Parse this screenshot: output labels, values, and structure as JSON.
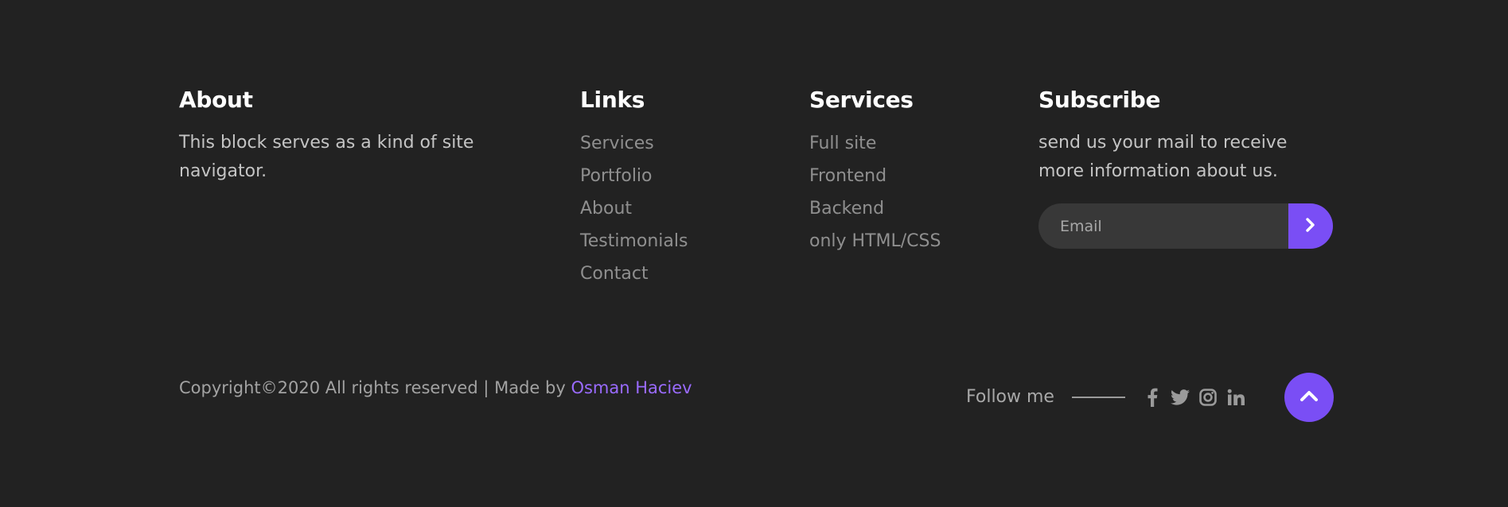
{
  "about": {
    "title": "About",
    "text": "This block serves as a kind of site navigator."
  },
  "links": {
    "title": "Links",
    "items": [
      "Services",
      "Portfolio",
      "About",
      "Testimonials",
      "Contact"
    ]
  },
  "services": {
    "title": "Services",
    "items": [
      "Full site",
      "Frontend",
      "Backend",
      "only HTML/CSS"
    ]
  },
  "subscribe": {
    "title": "Subscribe",
    "text": "send us your mail to receive more information about us.",
    "placeholder": "Email",
    "submit_icon": "chevron-right-icon"
  },
  "bottom": {
    "copyright": "Copyright©2020 All rights reserved | Made by ",
    "author": "Osman Haciev",
    "follow_label": "Follow me",
    "social_icons": [
      "facebook-icon",
      "twitter-icon",
      "instagram-icon",
      "linkedin-icon"
    ],
    "scroll_top_icon": "chevron-up-icon"
  },
  "colors": {
    "background": "#222222",
    "accent": "#7a4ef5",
    "author_link": "#9a6bff",
    "heading": "#ffffff",
    "link": "#8f8f8f",
    "input_bg": "#383838"
  }
}
